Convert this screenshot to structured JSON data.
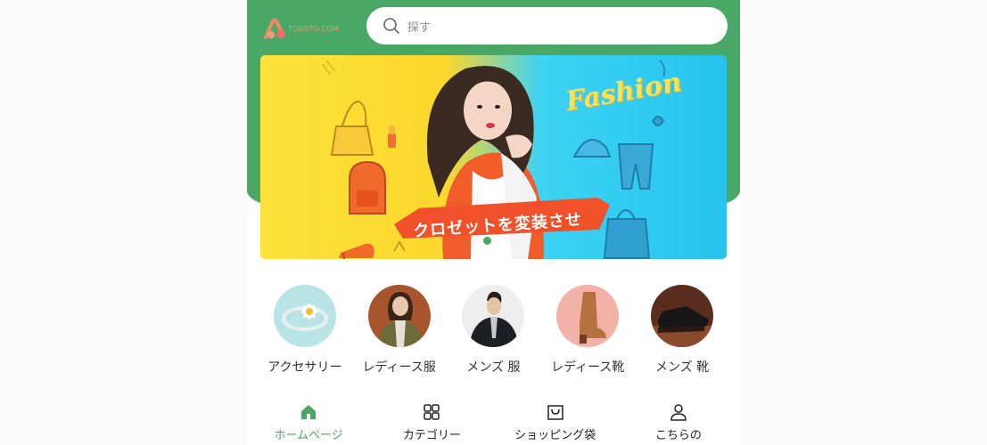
{
  "header": {
    "logo_text": "TOSOTO.COM",
    "search_placeholder": "探す"
  },
  "banner": {
    "tagline": "クロゼットを変装させ",
    "script_text": "Fashion",
    "slide_count": 2,
    "active_slide": 1
  },
  "categories": [
    {
      "label": "アクセサリー",
      "image": "ring-with-daisy"
    },
    {
      "label": "レディース服",
      "image": "woman-in-olive-jacket"
    },
    {
      "label": "メンズ 服",
      "image": "man-in-black-jacket"
    },
    {
      "label": "レディース靴",
      "image": "brown-ankle-boot"
    },
    {
      "label": "メンズ 靴",
      "image": "black-leather-shoe"
    }
  ],
  "tabbar": {
    "active": "home",
    "items": [
      {
        "id": "home",
        "label": "ホームページ",
        "icon": "home-icon"
      },
      {
        "id": "category",
        "label": "カテゴリー",
        "icon": "grid-icon"
      },
      {
        "id": "bag",
        "label": "ショッピング袋",
        "icon": "shopping-bag-icon"
      },
      {
        "id": "mine",
        "label": "こちらの",
        "icon": "user-icon"
      }
    ]
  },
  "colors": {
    "brand_green": "#4aa866",
    "logo_orange": "#f29a74",
    "banner_yellow": "#fde23a",
    "banner_blue": "#2fc8f0"
  }
}
